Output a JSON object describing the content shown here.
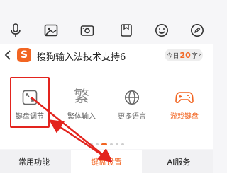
{
  "toolbar": {
    "icons": [
      "mic-icon",
      "image-icon",
      "camera-icon",
      "clipboard-icon",
      "emoji-icon",
      "edit-icon"
    ]
  },
  "suggestion": {
    "logo_letter": "S",
    "text": "搜狗输入法技术支持6",
    "today_prefix": "今日",
    "today_count": "20",
    "today_suffix": "字",
    "today_arrow": "›"
  },
  "panel": {
    "tiles": [
      {
        "label": "键盘调节",
        "icon": "resize-icon"
      },
      {
        "label": "繁体输入",
        "icon": "traditional-chinese-icon",
        "glyph": "繁"
      },
      {
        "label": "更多语言",
        "icon": "globe-icon"
      },
      {
        "label": "游戏键盘",
        "icon": "gamepad-icon"
      }
    ]
  },
  "tabs": {
    "common": "常用功能",
    "settings": "键盘设置",
    "ai": "AI服务"
  },
  "colors": {
    "accent": "#f26522",
    "annotation_red": "#e3241e"
  }
}
